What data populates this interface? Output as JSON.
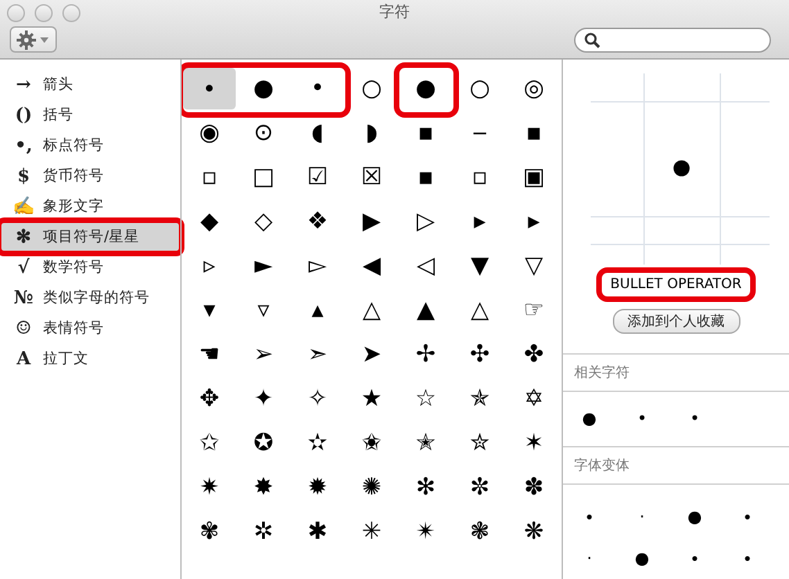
{
  "window": {
    "title": "字符"
  },
  "sidebar": {
    "items": [
      {
        "icon": "→",
        "label": "箭头",
        "selected": false,
        "highlighted": false
      },
      {
        "icon": "()",
        "label": "括号",
        "selected": false,
        "highlighted": false
      },
      {
        "icon": "•,",
        "label": "标点符号",
        "selected": false,
        "highlighted": false
      },
      {
        "icon": "$",
        "label": "货币符号",
        "selected": false,
        "highlighted": false
      },
      {
        "icon": "✍",
        "label": "象形文字",
        "selected": false,
        "highlighted": false
      },
      {
        "icon": "✻",
        "label": "项目符号/星星",
        "selected": true,
        "highlighted": true
      },
      {
        "icon": "√",
        "label": "数学符号",
        "selected": false,
        "highlighted": false
      },
      {
        "icon": "№",
        "label": "类似字母的符号",
        "selected": false,
        "highlighted": false
      },
      {
        "icon": "☺",
        "label": "表情符号",
        "selected": false,
        "highlighted": false
      },
      {
        "icon": "A",
        "label": "拉丁文",
        "selected": false,
        "highlighted": false
      }
    ]
  },
  "characters": {
    "cells": [
      {
        "char": "∙",
        "selected": true,
        "highlighted": true
      },
      {
        "char": "●",
        "selected": false,
        "highlighted": true
      },
      {
        "char": "•",
        "selected": false,
        "highlighted": true
      },
      {
        "char": "○",
        "selected": false,
        "highlighted": false
      },
      {
        "char": "●",
        "selected": false,
        "highlighted": true
      },
      {
        "char": "○",
        "selected": false,
        "highlighted": false
      },
      {
        "char": "◎",
        "selected": false,
        "highlighted": false
      },
      {
        "char": "◉",
        "selected": false,
        "highlighted": false
      },
      {
        "char": "⊙",
        "selected": false,
        "highlighted": false
      },
      {
        "char": "◖",
        "selected": false,
        "highlighted": false
      },
      {
        "char": "◗",
        "selected": false,
        "highlighted": false
      },
      {
        "char": "▪",
        "selected": false,
        "highlighted": false
      },
      {
        "char": "‒",
        "selected": false,
        "highlighted": false
      },
      {
        "char": "▪",
        "selected": false,
        "highlighted": false
      },
      {
        "char": "▫",
        "selected": false,
        "highlighted": false
      },
      {
        "char": "□",
        "selected": false,
        "highlighted": false
      },
      {
        "char": "☑",
        "selected": false,
        "highlighted": false
      },
      {
        "char": "☒",
        "selected": false,
        "highlighted": false
      },
      {
        "char": "▪",
        "selected": false,
        "highlighted": false
      },
      {
        "char": "▫",
        "selected": false,
        "highlighted": false
      },
      {
        "char": "▣",
        "selected": false,
        "highlighted": false
      },
      {
        "char": "◆",
        "selected": false,
        "highlighted": false
      },
      {
        "char": "◇",
        "selected": false,
        "highlighted": false
      },
      {
        "char": "❖",
        "selected": false,
        "highlighted": false
      },
      {
        "char": "▶",
        "selected": false,
        "highlighted": false
      },
      {
        "char": "▷",
        "selected": false,
        "highlighted": false
      },
      {
        "char": "▸",
        "selected": false,
        "highlighted": false
      },
      {
        "char": "▸",
        "selected": false,
        "highlighted": false
      },
      {
        "char": "▹",
        "selected": false,
        "highlighted": false
      },
      {
        "char": "►",
        "selected": false,
        "highlighted": false
      },
      {
        "char": "▻",
        "selected": false,
        "highlighted": false
      },
      {
        "char": "◀",
        "selected": false,
        "highlighted": false
      },
      {
        "char": "◁",
        "selected": false,
        "highlighted": false
      },
      {
        "char": "▼",
        "selected": false,
        "highlighted": false
      },
      {
        "char": "▽",
        "selected": false,
        "highlighted": false
      },
      {
        "char": "▾",
        "selected": false,
        "highlighted": false
      },
      {
        "char": "▿",
        "selected": false,
        "highlighted": false
      },
      {
        "char": "▴",
        "selected": false,
        "highlighted": false
      },
      {
        "char": "△",
        "selected": false,
        "highlighted": false
      },
      {
        "char": "▲",
        "selected": false,
        "highlighted": false
      },
      {
        "char": "△",
        "selected": false,
        "highlighted": false
      },
      {
        "char": "☞",
        "selected": false,
        "highlighted": false
      },
      {
        "char": "☚",
        "selected": false,
        "highlighted": false
      },
      {
        "char": "➢",
        "selected": false,
        "highlighted": false
      },
      {
        "char": "➣",
        "selected": false,
        "highlighted": false
      },
      {
        "char": "➤",
        "selected": false,
        "highlighted": false
      },
      {
        "char": "✢",
        "selected": false,
        "highlighted": false
      },
      {
        "char": "✣",
        "selected": false,
        "highlighted": false
      },
      {
        "char": "✤",
        "selected": false,
        "highlighted": false
      },
      {
        "char": "✥",
        "selected": false,
        "highlighted": false
      },
      {
        "char": "✦",
        "selected": false,
        "highlighted": false
      },
      {
        "char": "✧",
        "selected": false,
        "highlighted": false
      },
      {
        "char": "★",
        "selected": false,
        "highlighted": false
      },
      {
        "char": "☆",
        "selected": false,
        "highlighted": false
      },
      {
        "char": "✯",
        "selected": false,
        "highlighted": false
      },
      {
        "char": "✡",
        "selected": false,
        "highlighted": false
      },
      {
        "char": "✩",
        "selected": false,
        "highlighted": false
      },
      {
        "char": "✪",
        "selected": false,
        "highlighted": false
      },
      {
        "char": "✫",
        "selected": false,
        "highlighted": false
      },
      {
        "char": "✬",
        "selected": false,
        "highlighted": false
      },
      {
        "char": "✭",
        "selected": false,
        "highlighted": false
      },
      {
        "char": "✮",
        "selected": false,
        "highlighted": false
      },
      {
        "char": "✶",
        "selected": false,
        "highlighted": false
      },
      {
        "char": "✷",
        "selected": false,
        "highlighted": false
      },
      {
        "char": "✸",
        "selected": false,
        "highlighted": false
      },
      {
        "char": "✹",
        "selected": false,
        "highlighted": false
      },
      {
        "char": "✺",
        "selected": false,
        "highlighted": false
      },
      {
        "char": "✻",
        "selected": false,
        "highlighted": false
      },
      {
        "char": "✼",
        "selected": false,
        "highlighted": false
      },
      {
        "char": "✽",
        "selected": false,
        "highlighted": false
      },
      {
        "char": "✾",
        "selected": false,
        "highlighted": false
      },
      {
        "char": "✲",
        "selected": false,
        "highlighted": false
      },
      {
        "char": "✱",
        "selected": false,
        "highlighted": false
      },
      {
        "char": "✳",
        "selected": false,
        "highlighted": false
      },
      {
        "char": "✴",
        "selected": false,
        "highlighted": false
      },
      {
        "char": "❃",
        "selected": false,
        "highlighted": false
      },
      {
        "char": "❋",
        "selected": false,
        "highlighted": false
      }
    ]
  },
  "detail": {
    "preview": "∙",
    "name": {
      "value": "BULLET OPERATOR",
      "highlighted": true
    },
    "add_button": "添加到个人收藏",
    "related": {
      "title": "相关字符",
      "chars": [
        "●",
        "•",
        "•"
      ]
    },
    "variants": {
      "title": "字体变体",
      "chars": [
        "∙",
        "·",
        "●",
        "∙",
        "·",
        "●",
        "∙",
        "∙"
      ]
    }
  }
}
